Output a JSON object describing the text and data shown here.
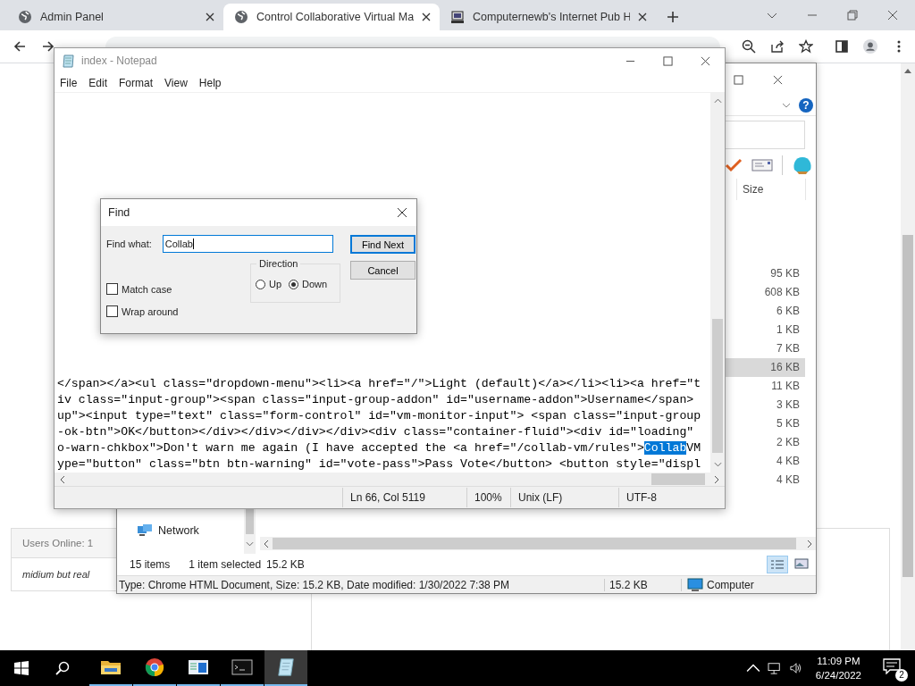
{
  "browser": {
    "tabs": [
      {
        "title": "Admin Panel",
        "kind": "globe",
        "selected": false
      },
      {
        "title": "Control Collaborative Virtual Ma",
        "kind": "globe",
        "selected": true
      },
      {
        "title": "Computernewb's Internet Pub H",
        "kind": "computer",
        "selected": false
      }
    ]
  },
  "page": {
    "users_online": "Users Online: 1",
    "user": "midium but real"
  },
  "explorer": {
    "help": "?",
    "column": "Size",
    "rows": [
      {
        "size": "95 KB",
        "selected": false
      },
      {
        "size": "608 KB",
        "selected": false
      },
      {
        "size": "6 KB",
        "selected": false
      },
      {
        "size": "1 KB",
        "selected": false
      },
      {
        "size": "7 KB",
        "selected": false
      },
      {
        "size": "16 KB",
        "selected": true
      },
      {
        "size": "11 KB",
        "selected": false
      },
      {
        "size": "3 KB",
        "selected": false
      },
      {
        "size": "5 KB",
        "selected": false
      },
      {
        "size": "2 KB",
        "selected": false
      },
      {
        "size": "4 KB",
        "selected": false
      },
      {
        "size": "4 KB",
        "selected": false
      }
    ],
    "nav_item": "Network",
    "item_count": "15 items",
    "selection_info": "1 item selected",
    "selection_size": "15.2 KB",
    "details": "Type: Chrome HTML Document, Size: 15.2 KB, Date modified: 1/30/2022 7:38 PM",
    "details_size": "15.2 KB",
    "location": "Computer"
  },
  "notepad": {
    "title": "index - Notepad",
    "menu": [
      "File",
      "Edit",
      "Format",
      "View",
      "Help"
    ],
    "lines": [
      {
        "text": "</span></a><ul class=\"dropdown-menu\"><li><a href=\"/\">Light (default)</a></li><li><a href=\"t"
      },
      {
        "text": "iv class=\"input-group\"><span class=\"input-group-addon\" id=\"username-addon\">Username</span>"
      },
      {
        "text": "up\"><input type=\"text\" class=\"form-control\" id=\"vm-monitor-input\"> <span class=\"input-group"
      },
      {
        "text": "-ok-btn\">OK</button></div></div></div></div><div class=\"container-fluid\"><div id=\"loading\""
      },
      {
        "text": "o-warn-chkbox\">Don't warn me again (I have accepted the <a href=\"/collab-vm/rules\">",
        "selected_text": "Collab",
        "text_after": "VM"
      },
      {
        "text": "ype=\"button\" class=\"btn btn-warning\" id=\"vote-pass\">Pass Vote</button> <button style=\"displ"
      }
    ],
    "status": [
      "Ln 66, Col 5119",
      "100%",
      "Unix (LF)",
      "UTF-8"
    ]
  },
  "find": {
    "title": "Find",
    "label": "Find what:",
    "value": "Collab",
    "find_next": "Find Next",
    "cancel": "Cancel",
    "direction": "Direction",
    "radios": [
      {
        "label": "Up",
        "selected": false
      },
      {
        "label": "Down",
        "selected": true
      }
    ],
    "checks": [
      {
        "label": "Match case",
        "checked": false
      },
      {
        "label": "Wrap around",
        "checked": false
      }
    ]
  },
  "taskbar": {
    "apps": [
      {
        "kind": "explorer",
        "selected": false
      },
      {
        "kind": "chrome",
        "selected": false
      },
      {
        "kind": "window",
        "selected": false
      },
      {
        "kind": "terminal",
        "selected": false
      },
      {
        "kind": "notepad",
        "selected": true
      }
    ],
    "time": "11:09 PM",
    "date": "6/24/2022",
    "notifications": "2"
  }
}
